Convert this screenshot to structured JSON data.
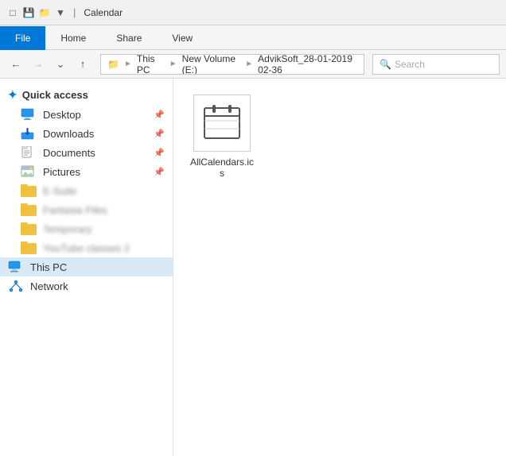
{
  "titleBar": {
    "title": "Calendar"
  },
  "ribbon": {
    "tabs": [
      "File",
      "Home",
      "Share",
      "View"
    ],
    "activeTab": "File"
  },
  "navBar": {
    "addressParts": [
      "This PC",
      "New Volume (E:)",
      "AdvikSoft_28-01-2019 02-36"
    ],
    "searchPlaceholder": "Search",
    "backDisabled": false,
    "forwardDisabled": true
  },
  "sidebar": {
    "quickAccessLabel": "Quick access",
    "items": [
      {
        "id": "desktop",
        "label": "Desktop",
        "pinned": true,
        "type": "desktop"
      },
      {
        "id": "downloads",
        "label": "Downloads",
        "pinned": true,
        "type": "download"
      },
      {
        "id": "documents",
        "label": "Documents",
        "pinned": true,
        "type": "documents"
      },
      {
        "id": "pictures",
        "label": "Pictures",
        "pinned": true,
        "type": "pictures"
      }
    ],
    "folders": [
      {
        "id": "f1",
        "label": "E-Suite"
      },
      {
        "id": "f2",
        "label": "Fantasia Files"
      },
      {
        "id": "f3",
        "label": "Temporary"
      },
      {
        "id": "f4",
        "label": "YouTube classes 2"
      }
    ],
    "thisPC": "This PC",
    "network": "Network"
  },
  "content": {
    "file": {
      "name": "AllCalendars.ics",
      "iconType": "calendar"
    }
  }
}
